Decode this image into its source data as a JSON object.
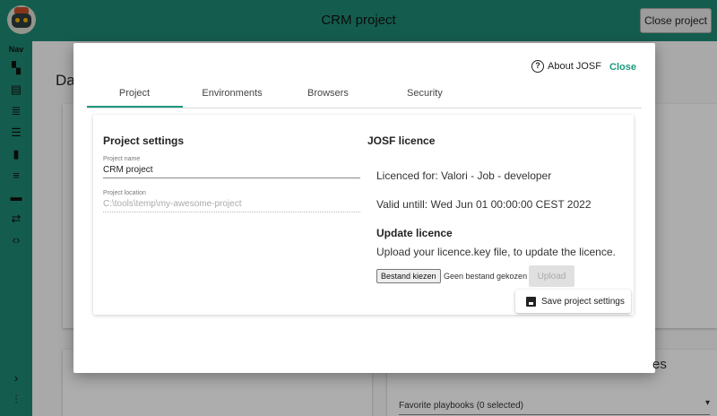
{
  "header": {
    "title": "CRM project",
    "close_project_label": "Close project"
  },
  "nav": {
    "label": "Nav",
    "icons": [
      "dashboard-icon",
      "list-icon",
      "text-icon",
      "checklist-icon",
      "book-icon",
      "columns-icon",
      "rows-icon",
      "swap-icon",
      "code-icon",
      "chevron-right-icon",
      "sliders-icon"
    ]
  },
  "background": {
    "page_title": "Das",
    "card_title_suffix": "es",
    "favorite_playbooks": "Favorite playbooks (0 selected)"
  },
  "dialog": {
    "about_label": "About JOSF",
    "close_label": "Close",
    "tabs": [
      {
        "label": "Project"
      },
      {
        "label": "Environments"
      },
      {
        "label": "Browsers"
      },
      {
        "label": "Security"
      }
    ],
    "active_tab": "Project",
    "project_settings": {
      "heading": "Project settings",
      "name_label": "Project name",
      "name_value": "CRM project",
      "location_label": "Project location",
      "location_value": "C:\\tools\\temp\\my-awesome-project"
    },
    "licence": {
      "heading": "JOSF licence",
      "licenced_for": "Licenced for: Valori - Job - developer",
      "valid_until": "Valid untill: Wed Jun 01 00:00:00 CEST 2022",
      "update_heading": "Update licence",
      "update_text": "Upload your licence.key file, to update the licence.",
      "choose_file_label": "Bestand kiezen",
      "no_file_label": "Geen bestand gekozen",
      "upload_label": "Upload"
    },
    "save_label": "Save project settings"
  },
  "colors": {
    "brand": "#1e8a74",
    "accent": "#1e9a7f"
  }
}
